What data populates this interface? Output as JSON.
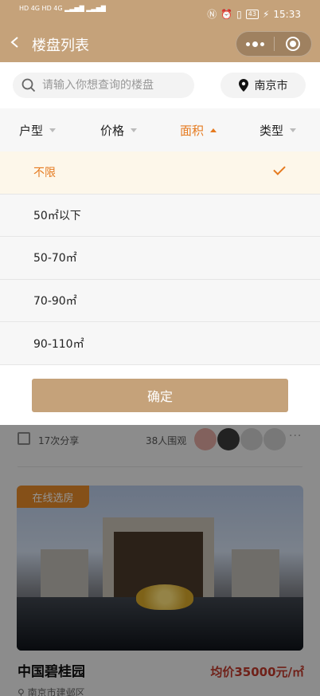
{
  "status_bar": {
    "signal_left": "HD 4G HD 4G",
    "battery": "43",
    "time": "15:33"
  },
  "nav": {
    "title": "楼盘列表"
  },
  "search": {
    "placeholder": "请输入你想查询的楼盘",
    "city": "南京市"
  },
  "filters": {
    "tabs": [
      {
        "label": "户型",
        "active": false
      },
      {
        "label": "价格",
        "active": false
      },
      {
        "label": "面积",
        "active": true
      },
      {
        "label": "类型",
        "active": false
      }
    ]
  },
  "area_options": [
    {
      "label": "不限",
      "selected": true
    },
    {
      "label": "50㎡以下",
      "selected": false
    },
    {
      "label": "50-70㎡",
      "selected": false
    },
    {
      "label": "70-90㎡",
      "selected": false
    },
    {
      "label": "90-110㎡",
      "selected": false
    }
  ],
  "confirm_label": "确定",
  "listing": {
    "shares": "17次分享",
    "views": "38人围观",
    "badge": "在线选房",
    "name": "中国碧桂园",
    "price": "均价35000元/㎡",
    "address": "南京市建邺区"
  },
  "colors": {
    "brand": "#c5a27a",
    "accent": "#e57a1f",
    "price": "#c0392b"
  }
}
